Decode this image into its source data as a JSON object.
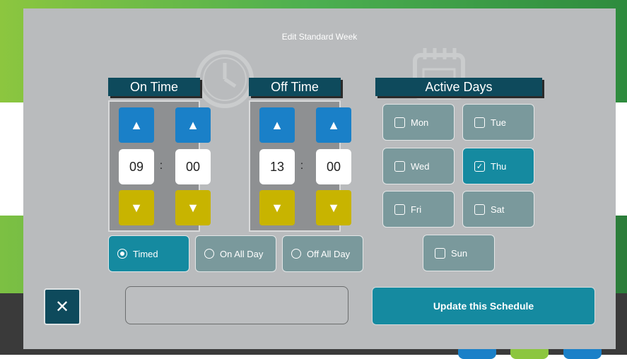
{
  "modal": {
    "title": "Edit Standard Week"
  },
  "on_time": {
    "label": "On Time",
    "hours": "09",
    "minutes": "00",
    "separator": ":"
  },
  "off_time": {
    "label": "Off Time",
    "hours": "13",
    "minutes": "00",
    "separator": ":"
  },
  "active_days": {
    "label": "Active Days",
    "days": [
      {
        "label": "Mon",
        "checked": false
      },
      {
        "label": "Tue",
        "checked": false
      },
      {
        "label": "Wed",
        "checked": false
      },
      {
        "label": "Thu",
        "checked": true
      },
      {
        "label": "Fri",
        "checked": false
      },
      {
        "label": "Sat",
        "checked": false
      },
      {
        "label": "Sun",
        "checked": false
      }
    ]
  },
  "modes": [
    {
      "label": "Timed",
      "selected": true
    },
    {
      "label": "On All Day",
      "selected": false
    },
    {
      "label": "Off All Day",
      "selected": false
    }
  ],
  "buttons": {
    "update_label": "Update this Schedule"
  },
  "icons": {
    "up": "arrow-up-icon",
    "down": "arrow-down-icon",
    "close": "close-icon"
  },
  "colors": {
    "accent": "#158aa0",
    "header": "#0e4a5c",
    "up": "#1a80c8",
    "down": "#c8b400"
  }
}
